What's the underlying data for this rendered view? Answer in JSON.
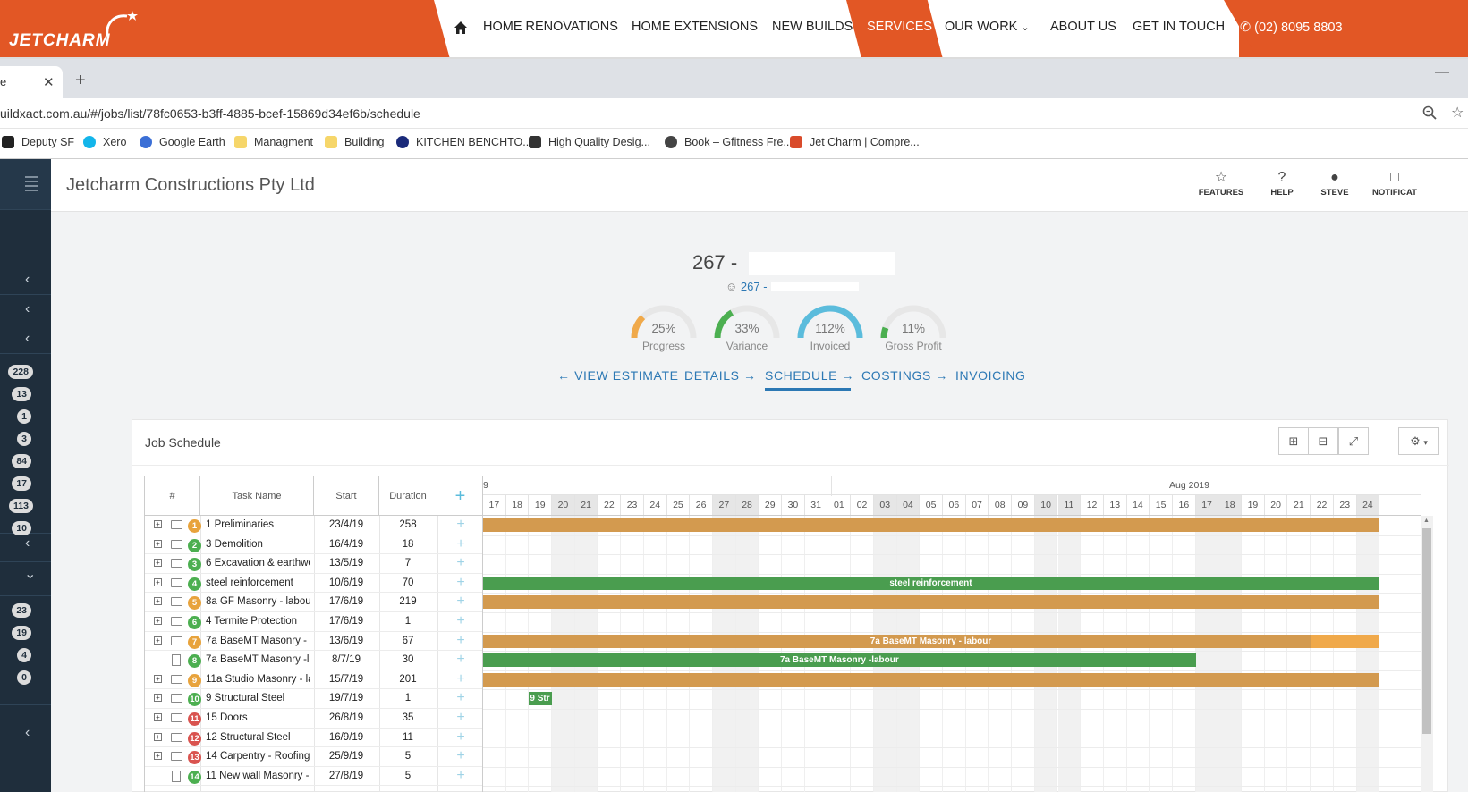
{
  "site": {
    "logo_text": "JETCHARM",
    "nav": [
      "HOME RENOVATIONS",
      "HOME EXTENSIONS",
      "NEW BUILDS",
      "SERVICES",
      "OUR WORK",
      "ABOUT US",
      "GET IN TOUCH"
    ],
    "active_nav": "SERVICES",
    "phone": "(02) 8095 8803",
    "brand_color": "#e25725"
  },
  "browser": {
    "tab_title": "e",
    "url": "uildxact.com.au/#/jobs/list/78fc0653-b3ff-4885-bcef-15869d34ef6b/schedule",
    "bookmarks": [
      {
        "label": "Deputy SF",
        "icon": "deputy-icon",
        "color": "#222222"
      },
      {
        "label": "Xero",
        "icon": "xero-icon",
        "color": "#13b5ea"
      },
      {
        "label": "Google Earth",
        "icon": "google-earth-icon",
        "color": "#3b6fd6"
      },
      {
        "label": "Managment",
        "icon": "folder-icon",
        "color": "#f6d66a"
      },
      {
        "label": "Building",
        "icon": "folder-icon",
        "color": "#f6d66a"
      },
      {
        "label": "KITCHEN BENCHTO...",
        "icon": "diy-icon",
        "color": "#1a2a7a"
      },
      {
        "label": "High Quality Desig...",
        "icon": "brush-icon",
        "color": "#333333"
      },
      {
        "label": "Book – Gfitness Fre...",
        "icon": "globe-icon",
        "color": "#444444"
      },
      {
        "label": "Jet Charm | Compre...",
        "icon": "jetcharm-icon",
        "color": "#d94b2b"
      }
    ]
  },
  "sidebar": {
    "badges": [
      "228",
      "13",
      "1",
      "3",
      "84",
      "17",
      "113",
      "10",
      "23",
      "19",
      "4",
      "0"
    ]
  },
  "header": {
    "company": "Jetcharm Constructions Pty Ltd",
    "tools": [
      {
        "label": "FEATURES",
        "icon": "star-icon"
      },
      {
        "label": "HELP",
        "icon": "help-icon"
      },
      {
        "label": "STEVE",
        "icon": "user-icon"
      },
      {
        "label": "NOTIFICAT",
        "icon": "notification-icon"
      }
    ]
  },
  "job": {
    "title": "267 -",
    "subtitle": "267 -",
    "gauges": [
      {
        "value": "25%",
        "label": "Progress",
        "fraction": 0.25,
        "color": "#f0a94a"
      },
      {
        "value": "33%",
        "label": "Variance",
        "fraction": 0.33,
        "color": "#4caf50"
      },
      {
        "value": "112%",
        "label": "Invoiced",
        "fraction": 1.0,
        "color": "#5bbcdc"
      },
      {
        "value": "11%",
        "label": "Gross Profit",
        "fraction": 0.11,
        "color": "#4caf50"
      }
    ],
    "nav": {
      "view_estimate": "VIEW ESTIMATE",
      "details": "DETAILS",
      "schedule": "SCHEDULE",
      "costings": "COSTINGS",
      "invoicing": "INVOICING"
    }
  },
  "schedule": {
    "title": "Job Schedule",
    "columns": {
      "num": "#",
      "task": "Task Name",
      "start": "Start",
      "duration": "Duration"
    },
    "month_left": "9",
    "month_right": "Aug 2019",
    "days": [
      "17",
      "18",
      "19",
      "20",
      "21",
      "22",
      "23",
      "24",
      "25",
      "26",
      "27",
      "28",
      "29",
      "30",
      "31",
      "01",
      "02",
      "03",
      "04",
      "05",
      "06",
      "07",
      "08",
      "09",
      "10",
      "11",
      "12",
      "13",
      "14",
      "15",
      "16",
      "17",
      "18",
      "19",
      "20",
      "21",
      "22",
      "23",
      "24"
    ],
    "weekend_days": [
      3,
      4,
      10,
      11,
      17,
      18,
      24,
      25,
      31,
      32,
      38
    ],
    "tasks": [
      {
        "n": "1",
        "name": "1 Preliminaries",
        "start": "23/4/19",
        "duration": "258",
        "color": "#e8a33c",
        "folder": true
      },
      {
        "n": "2",
        "name": "3 Demolition",
        "start": "16/4/19",
        "duration": "18",
        "color": "#4caf50",
        "folder": true
      },
      {
        "n": "3",
        "name": "6 Excavation & earthwo",
        "start": "13/5/19",
        "duration": "7",
        "color": "#4caf50",
        "folder": true
      },
      {
        "n": "4",
        "name": "steel reinforcement",
        "start": "10/6/19",
        "duration": "70",
        "color": "#4caf50",
        "folder": true
      },
      {
        "n": "5",
        "name": "8a GF Masonry - labou",
        "start": "17/6/19",
        "duration": "219",
        "color": "#e8a33c",
        "folder": true
      },
      {
        "n": "6",
        "name": "4 Termite Protection",
        "start": "17/6/19",
        "duration": "1",
        "color": "#4caf50",
        "folder": true
      },
      {
        "n": "7",
        "name": "7a BaseMT Masonry - l",
        "start": "13/6/19",
        "duration": "67",
        "color": "#e8a33c",
        "folder": true
      },
      {
        "n": "8",
        "name": "7a BaseMT Masonry -la",
        "start": "8/7/19",
        "duration": "30",
        "color": "#4caf50",
        "folder": false
      },
      {
        "n": "9",
        "name": "11a Studio Masonry - la",
        "start": "15/7/19",
        "duration": "201",
        "color": "#e8a33c",
        "folder": true
      },
      {
        "n": "10",
        "name": "9 Structural Steel",
        "start": "19/7/19",
        "duration": "1",
        "color": "#4caf50",
        "folder": true
      },
      {
        "n": "11",
        "name": "15 Doors",
        "start": "26/8/19",
        "duration": "35",
        "color": "#d9534f",
        "folder": true
      },
      {
        "n": "12",
        "name": "12 Structural Steel",
        "start": "16/9/19",
        "duration": "11",
        "color": "#d9534f",
        "folder": true
      },
      {
        "n": "13",
        "name": "14 Carpentry - Roofing",
        "start": "25/9/19",
        "duration": "5",
        "color": "#d9534f",
        "folder": true
      },
      {
        "n": "14",
        "name": "11 New wall Masonry -",
        "start": "27/8/19",
        "duration": "5",
        "color": "#4caf50",
        "folder": false
      }
    ],
    "bars": [
      {
        "row": 0,
        "from": 0,
        "to": 39,
        "color": "#d39a4f",
        "label": ""
      },
      {
        "row": 3,
        "from": 0,
        "to": 39,
        "color": "#4a9d4f",
        "label": "steel reinforcement"
      },
      {
        "row": 4,
        "from": 0,
        "to": 39,
        "color": "#d39a4f",
        "label": ""
      },
      {
        "row": 6,
        "from": 0,
        "to": 39,
        "color": "#d39a4f",
        "label": "7a BaseMT Masonry - labour",
        "split": 36,
        "split_color": "#f0a94a"
      },
      {
        "row": 7,
        "from": 0,
        "to": 31,
        "color": "#4a9d4f",
        "label": "7a BaseMT Masonry -labour"
      },
      {
        "row": 8,
        "from": 0,
        "to": 39,
        "color": "#d39a4f",
        "label": ""
      },
      {
        "row": 9,
        "from": 2,
        "to": 3,
        "color": "#4a9d4f",
        "label": "9 Str"
      }
    ]
  }
}
